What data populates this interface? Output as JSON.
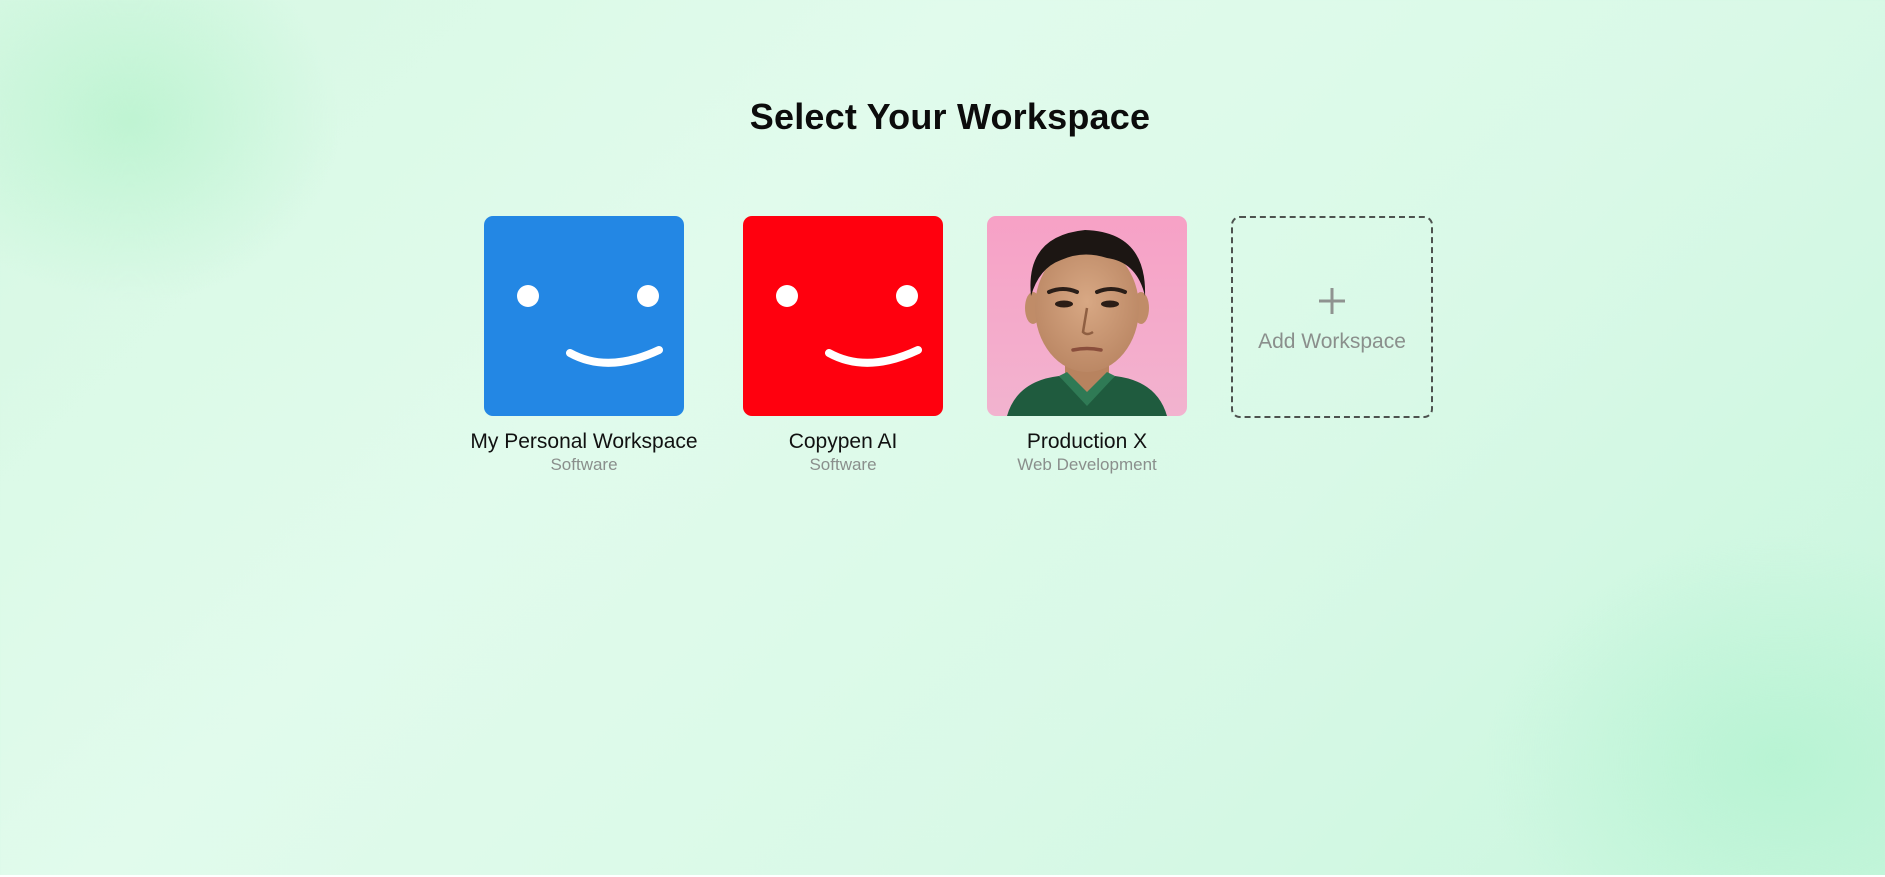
{
  "page": {
    "title": "Select Your Workspace"
  },
  "workspaces": [
    {
      "name": "My Personal Workspace",
      "type": "Software",
      "avatar": "smiley-face-icon",
      "color": "#2387e4"
    },
    {
      "name": "Copypen AI",
      "type": "Software",
      "avatar": "smiley-face-icon",
      "color": "#ff000e"
    },
    {
      "name": "Production X",
      "type": "Web Development",
      "avatar": "profile-photo",
      "color": "#f7a6c9"
    }
  ],
  "add_workspace": {
    "label": "Add Workspace",
    "icon": "plus-icon"
  }
}
